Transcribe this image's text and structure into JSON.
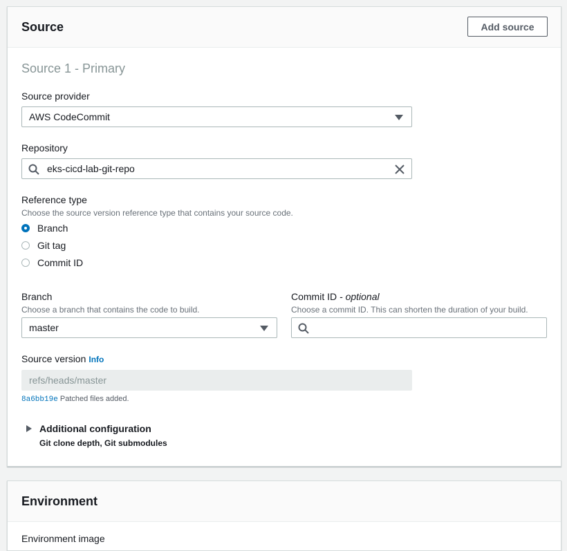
{
  "source_panel": {
    "title": "Source",
    "add_source_label": "Add source",
    "subtitle": "Source 1 - Primary",
    "source_provider": {
      "label": "Source provider",
      "value": "AWS CodeCommit"
    },
    "repository": {
      "label": "Repository",
      "value": "eks-cicd-lab-git-repo"
    },
    "reference_type": {
      "label": "Reference type",
      "description": "Choose the source version reference type that contains your source code.",
      "options": [
        "Branch",
        "Git tag",
        "Commit ID"
      ],
      "selected": "Branch"
    },
    "branch": {
      "label": "Branch",
      "description": "Choose a branch that contains the code to build.",
      "value": "master"
    },
    "commit_id": {
      "label": "Commit ID",
      "optional": "- optional",
      "description": "Choose a commit ID. This can shorten the duration of your build.",
      "value": ""
    },
    "source_version": {
      "label": "Source version",
      "info": "Info",
      "value": "refs/heads/master",
      "commit_hash": "8a6bb19e",
      "commit_message": "Patched files added."
    },
    "additional_configuration": {
      "label": "Additional configuration",
      "description": "Git clone depth, Git submodules"
    }
  },
  "environment_panel": {
    "title": "Environment",
    "next_label": "Environment image"
  },
  "colors": {
    "accent": "#0073bb",
    "page_background": "#f2f3f3",
    "border": "#aab7b8"
  }
}
